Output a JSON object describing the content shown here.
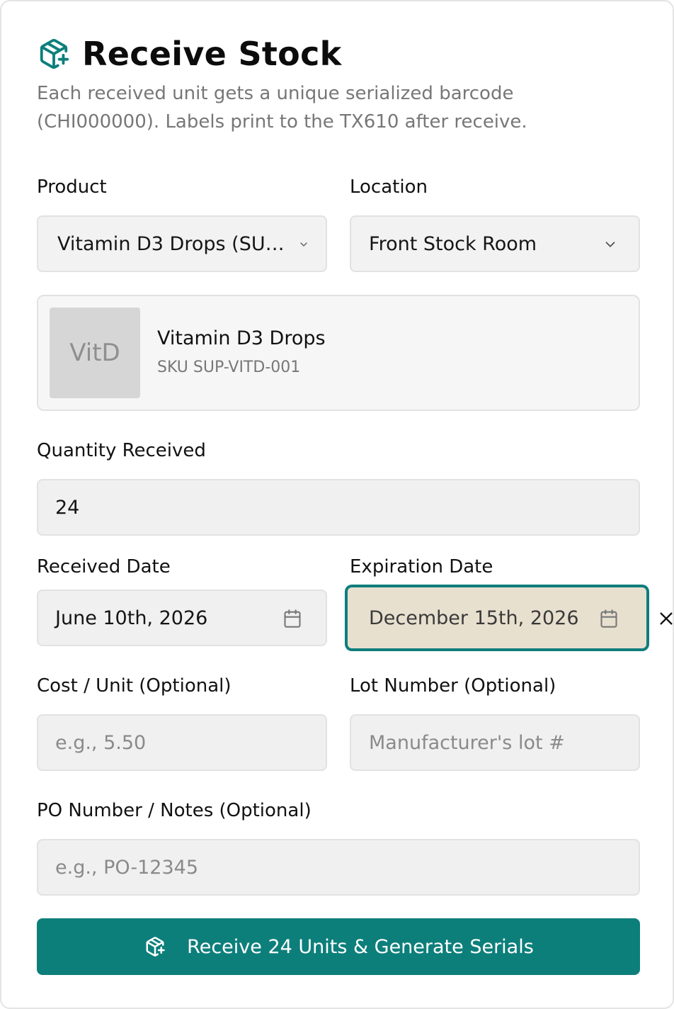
{
  "header": {
    "title": "Receive Stock",
    "icon": "package-plus-icon",
    "subtitle": "Each received unit gets a unique serialized barcode (CHI000000). Labels print to the TX610 after receive."
  },
  "product": {
    "label": "Product",
    "selected": "Vitamin D3 Drops (SU…"
  },
  "location": {
    "label": "Location",
    "selected": "Front Stock Room"
  },
  "product_card": {
    "thumb_text": "VitD",
    "name": "Vitamin D3 Drops",
    "sku": "SKU SUP-VITD-001"
  },
  "quantity": {
    "label": "Quantity Received",
    "value": "24"
  },
  "received_date": {
    "label": "Received Date",
    "value": "June 10th, 2026"
  },
  "expiration_date": {
    "label": "Expiration Date",
    "value": "December 15th, 2026"
  },
  "cost": {
    "label": "Cost / Unit (Optional)",
    "placeholder": "e.g., 5.50"
  },
  "lot": {
    "label": "Lot Number (Optional)",
    "placeholder": "Manufacturer's lot #"
  },
  "po": {
    "label": "PO Number / Notes (Optional)",
    "placeholder": "e.g., PO-12345"
  },
  "submit": {
    "label": "Receive 24 Units & Generate Serials"
  },
  "colors": {
    "accent": "#0d7f7b",
    "focus_field_bg": "#e8e0cf"
  }
}
